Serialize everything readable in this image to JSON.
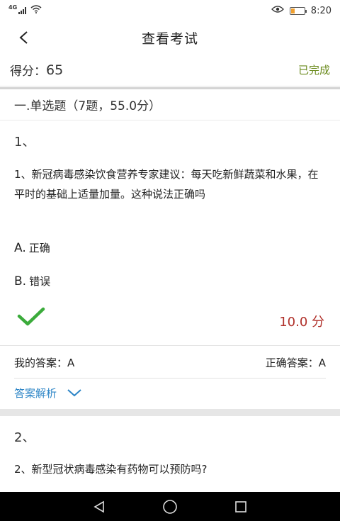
{
  "status_bar": {
    "network": "4G",
    "time": "8:20",
    "battery_level": 0.25,
    "icons": [
      "signal-icon",
      "wifi-icon",
      "eye-icon",
      "battery-icon"
    ]
  },
  "header": {
    "title": "查看考试",
    "back_icon": "chevron-left-icon"
  },
  "score": {
    "label": "得分：",
    "value": "65",
    "status": "已完成"
  },
  "section": {
    "title": "一.单选题（7题，55.0分）"
  },
  "questions": [
    {
      "number": "1、",
      "text": " 1、新冠病毒感染饮食营养专家建议：每天吃新鲜蔬菜和水果，在平时的基础上适量加量。这种说法正确吗",
      "options": [
        {
          "letter": "A.",
          "text": "正确"
        },
        {
          "letter": "B.",
          "text": "错误"
        }
      ],
      "result_icon": "checkmark-icon",
      "points": "10.0 分",
      "my_answer": "我的答案：A",
      "correct_answer": "正确答案：A",
      "analysis_label": "答案解析"
    },
    {
      "number": "2、",
      "text": "2、新型冠状病毒感染有药物可以预防吗?"
    }
  ],
  "colors": {
    "done_green": "#6a8a1c",
    "points_red": "#b0302a",
    "check_green": "#3bab3b",
    "link_blue": "#2b84c6"
  },
  "nav_bar": {
    "icons": [
      "back-triangle-icon",
      "home-circle-icon",
      "recents-square-icon"
    ]
  }
}
